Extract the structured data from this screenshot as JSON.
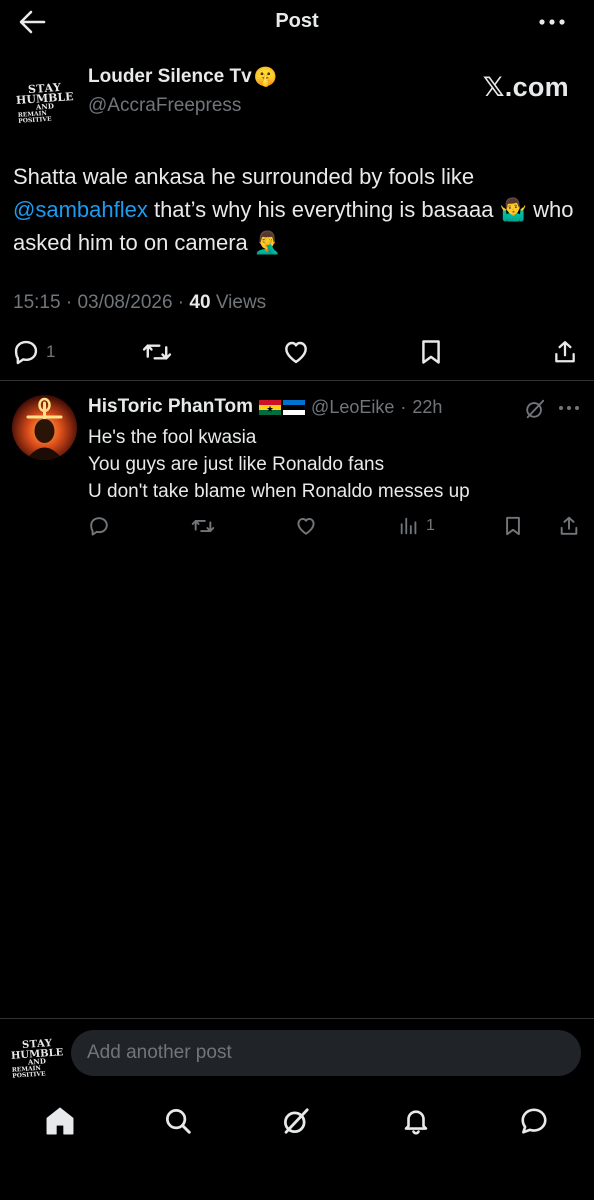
{
  "header": {
    "title": "Post",
    "back_icon": "arrow-left-icon",
    "more_icon": "more-horizontal-icon"
  },
  "author_logo": {
    "line1": "STAY",
    "line2": "HUMBLE",
    "line3": "AND",
    "line4": "REMAIN POSITIVE"
  },
  "post": {
    "author_name": "Louder Silence Tv",
    "author_emoji": "🤫",
    "author_handle": "@AccraFreepress",
    "watermark": "𝕏.com",
    "text_part1": "Shatta wale ankasa he surrounded by fools like ",
    "mention": "@sambahflex",
    "text_part2": " that’s why his everything is basaaa ",
    "emoji1": "🤷‍♂️",
    "text_part3": " who asked him to on camera ",
    "emoji2": "🤦‍♂️",
    "time": "15:15",
    "date": "03/08/2026",
    "views_count": "40",
    "views_label": "Views",
    "reply_count": "1"
  },
  "reply": {
    "name": "HisToric PhanTom",
    "handle": "@LeoEike",
    "time": "22h",
    "lines": [
      "He's the fool kwasia",
      "You guys are just like Ronaldo fans",
      "U don't take blame when Ronaldo messes up"
    ],
    "views_count": "1"
  },
  "composer": {
    "placeholder": "Add another post"
  },
  "colors": {
    "background": "#000000",
    "text": "#e7e9ea",
    "muted": "#71767b",
    "link": "#1d9bf0",
    "divider": "#2f3336",
    "input_bg": "#202327"
  },
  "bottom_nav": [
    "home-icon",
    "search-icon",
    "grok-icon",
    "notifications-icon",
    "messages-icon"
  ]
}
